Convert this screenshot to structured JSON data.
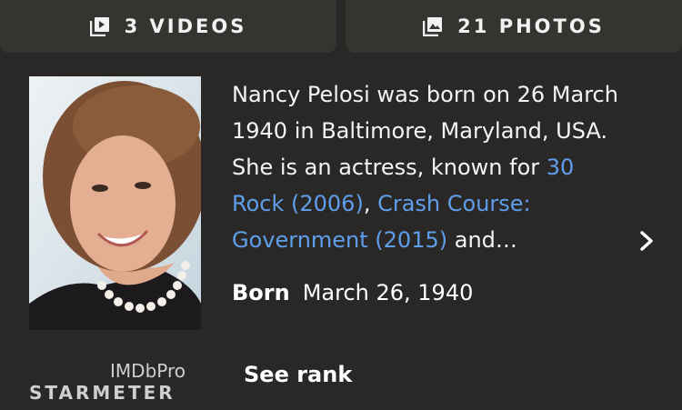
{
  "media_bar": {
    "videos_label": "3 VIDEOS",
    "videos_icon": "video-library-icon",
    "photos_label": "21 PHOTOS",
    "photos_icon": "photo-library-icon"
  },
  "profile": {
    "bio_part1": "Nancy Pelosi was born on 26 March 1940 in Baltimore, Maryland, USA. She is an actress, known for ",
    "link1": "30 Rock (2006)",
    "sep": ", ",
    "link2": "Crash Course: Government (2015)",
    "bio_end": " and…",
    "born_label": "Born",
    "born_value": "March 26, 1940"
  },
  "starmeter": {
    "pro_label": "IMDbPro",
    "meter_label": "STARMETER",
    "see_rank": "See rank"
  },
  "colors": {
    "link": "#5f9eea",
    "background": "#2a2826",
    "button": "#363431"
  }
}
